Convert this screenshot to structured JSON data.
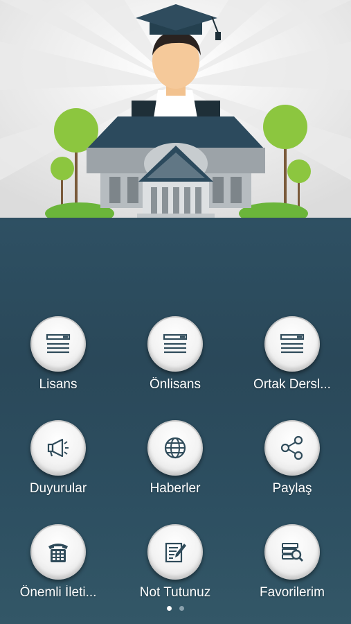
{
  "menu": {
    "items": [
      {
        "label": "Lisans",
        "icon": "list-icon"
      },
      {
        "label": "Önlisans",
        "icon": "list-icon"
      },
      {
        "label": "Ortak Dersl...",
        "icon": "list-icon"
      },
      {
        "label": "Duyurular",
        "icon": "megaphone-icon"
      },
      {
        "label": "Haberler",
        "icon": "globe-icon"
      },
      {
        "label": "Paylaş",
        "icon": "share-icon"
      },
      {
        "label": "Önemli İleti...",
        "icon": "phone-icon"
      },
      {
        "label": "Not Tutunuz",
        "icon": "notepad-icon"
      },
      {
        "label": "Favorilerim",
        "icon": "book-search-icon"
      }
    ]
  },
  "pager": {
    "pages": 2,
    "current": 1
  },
  "colors": {
    "panel": "#2b4a5c",
    "icon": "#2f4b5a",
    "tile": "#f3f3f3"
  }
}
